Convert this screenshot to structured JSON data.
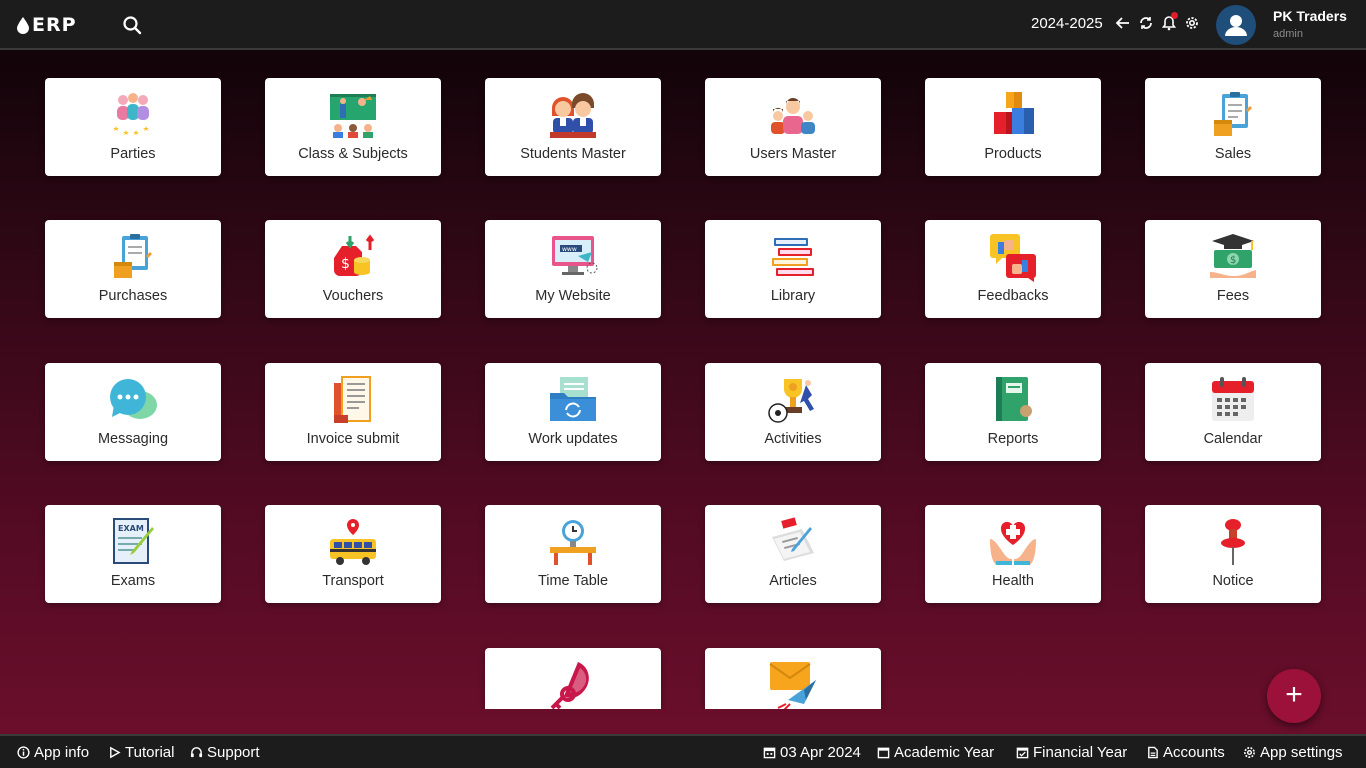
{
  "header": {
    "logo_text": "ERP",
    "financial_year": "2024-2025",
    "company_name": "PK Traders",
    "user_role": "admin"
  },
  "tiles": [
    {
      "label": "Parties",
      "icon": "parties-icon"
    },
    {
      "label": "Class & Subjects",
      "icon": "class-subjects-icon"
    },
    {
      "label": "Students Master",
      "icon": "students-icon"
    },
    {
      "label": "Users Master",
      "icon": "users-icon"
    },
    {
      "label": "Products",
      "icon": "products-icon"
    },
    {
      "label": "Sales",
      "icon": "sales-icon"
    },
    {
      "label": "Purchases",
      "icon": "purchases-icon"
    },
    {
      "label": "Vouchers",
      "icon": "vouchers-icon"
    },
    {
      "label": "My Website",
      "icon": "website-icon"
    },
    {
      "label": "Library",
      "icon": "library-icon"
    },
    {
      "label": "Feedbacks",
      "icon": "feedbacks-icon"
    },
    {
      "label": "Fees",
      "icon": "fees-icon"
    },
    {
      "label": "Messaging",
      "icon": "messaging-icon"
    },
    {
      "label": "Invoice submit",
      "icon": "invoice-icon"
    },
    {
      "label": "Work updates",
      "icon": "work-updates-icon"
    },
    {
      "label": "Activities",
      "icon": "activities-icon"
    },
    {
      "label": "Reports",
      "icon": "reports-icon"
    },
    {
      "label": "Calendar",
      "icon": "calendar-icon"
    },
    {
      "label": "Exams",
      "icon": "exams-icon"
    },
    {
      "label": "Transport",
      "icon": "transport-icon"
    },
    {
      "label": "Time Table",
      "icon": "timetable-icon"
    },
    {
      "label": "Articles",
      "icon": "articles-icon"
    },
    {
      "label": "Health",
      "icon": "health-icon"
    },
    {
      "label": "Notice",
      "icon": "notice-icon"
    },
    {
      "label": "",
      "icon": "key-icon"
    },
    {
      "label": "",
      "icon": "mail-icon"
    }
  ],
  "fab": {
    "label": "+"
  },
  "footer": {
    "app_info": "App info",
    "tutorial": "Tutorial",
    "support": "Support",
    "date": "03 Apr 2024",
    "academic_year": "Academic Year",
    "financial_year": "Financial Year",
    "accounts": "Accounts",
    "app_settings": "App settings"
  },
  "colors": {
    "topbar": "#1c1c1c",
    "accent": "#9c1139",
    "background_gradient_end": "#6e0f2d"
  }
}
